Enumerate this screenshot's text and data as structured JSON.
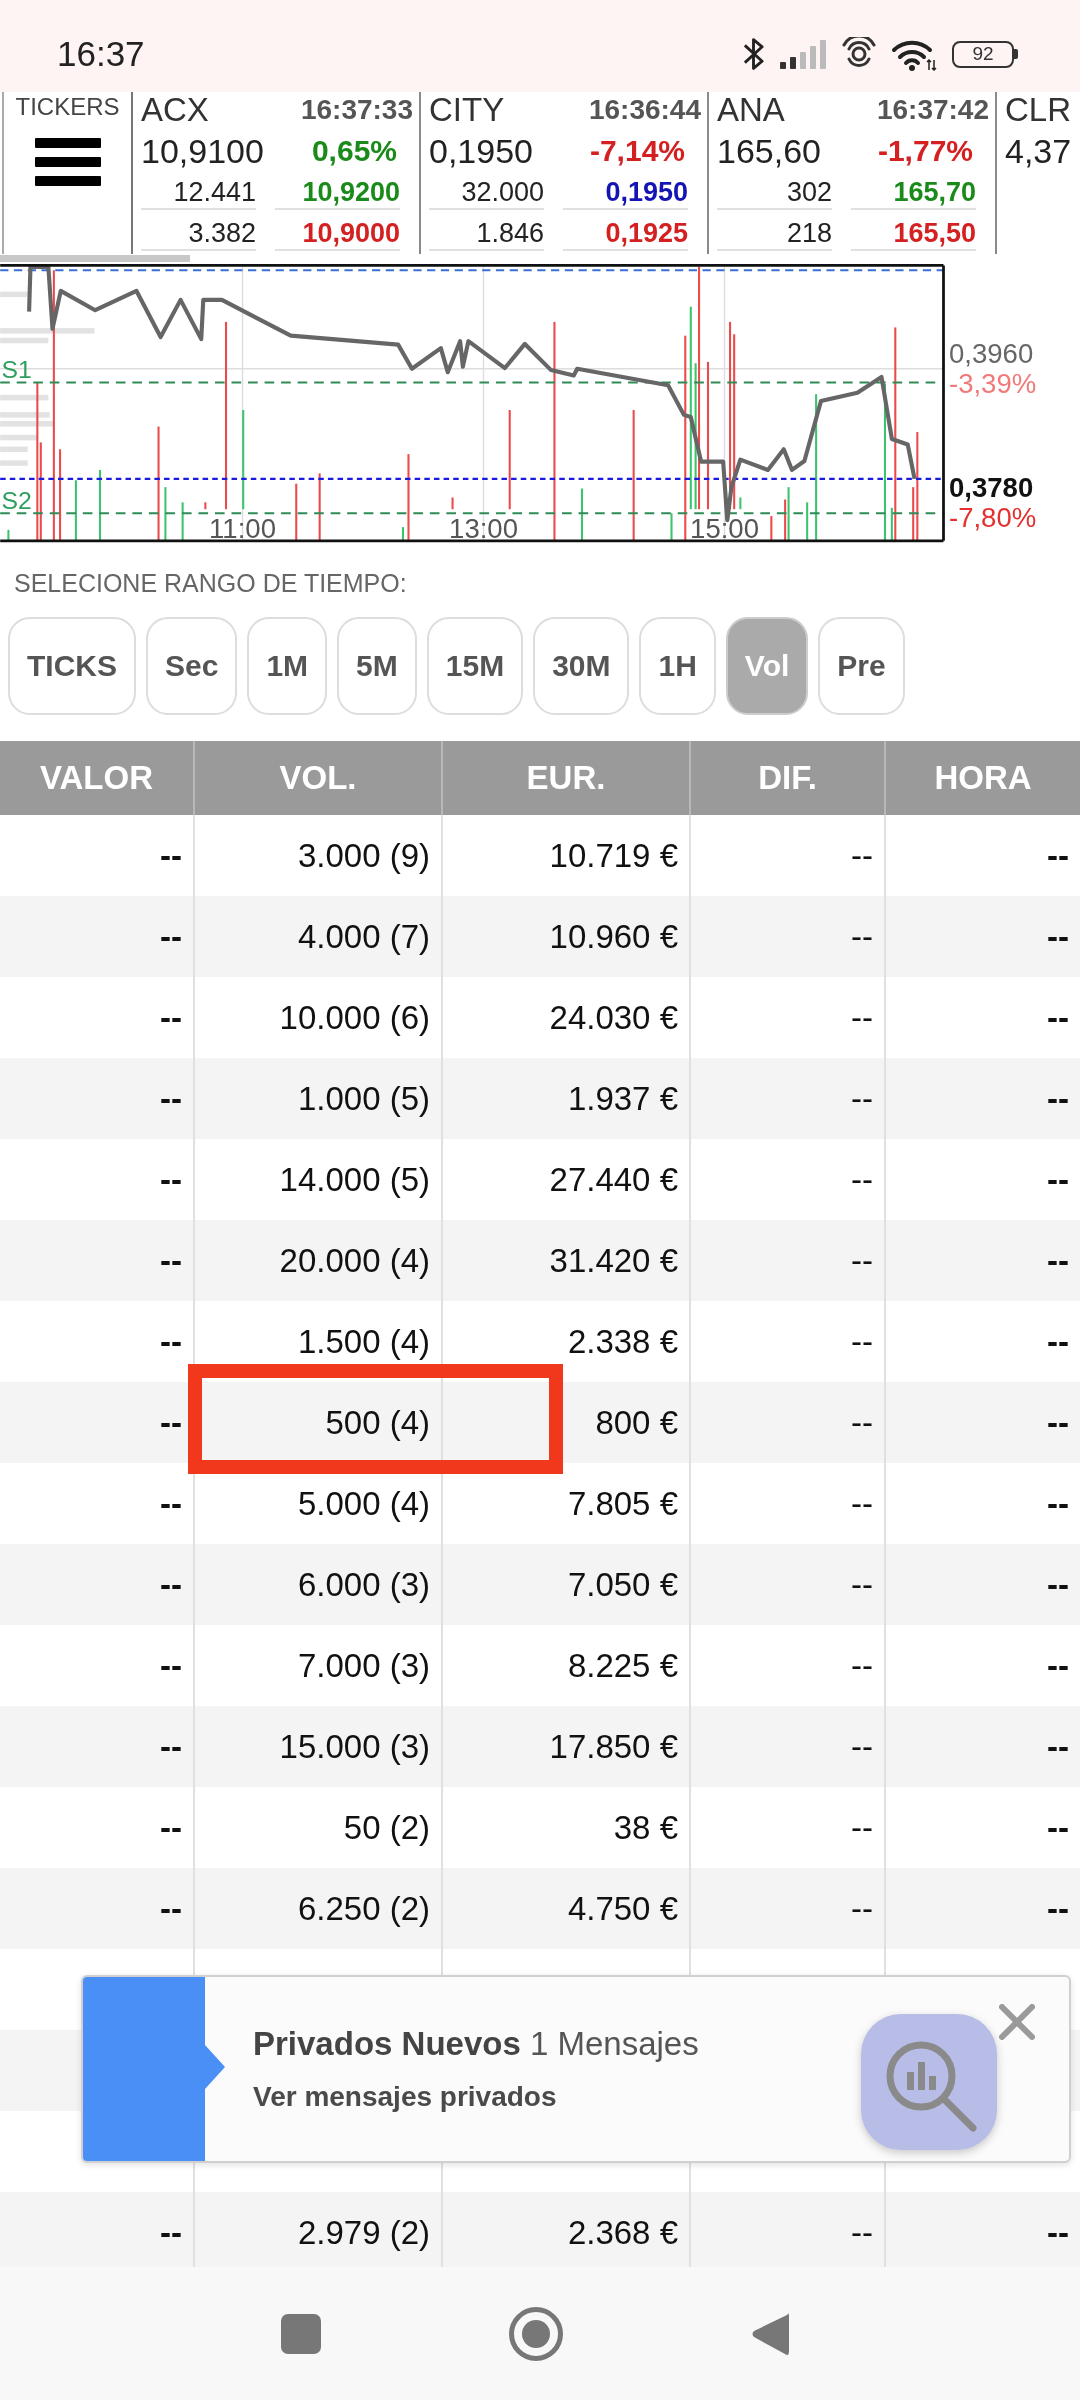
{
  "status_bar": {
    "time": "16:37",
    "battery": "92"
  },
  "tickers": {
    "label": "TICKERS",
    "items": [
      {
        "symbol": "ACX",
        "time": "16:37:33",
        "price": "10,9100",
        "change": {
          "text": "0,65%",
          "color": "#1a8a1a"
        },
        "quotes": [
          {
            "volume": "12.441",
            "price": "10,9200",
            "color": "#1a8a1a"
          },
          {
            "volume": "3.382",
            "price": "10,9000",
            "color": "#d42020"
          }
        ]
      },
      {
        "symbol": "CITY",
        "time": "16:36:44",
        "price": "0,1950",
        "change": {
          "text": "-7,14%",
          "color": "#d42020"
        },
        "quotes": [
          {
            "volume": "32.000",
            "price": "0,1950",
            "color": "#1414b4"
          },
          {
            "volume": "1.846",
            "price": "0,1925",
            "color": "#d42020"
          }
        ]
      },
      {
        "symbol": "ANA",
        "time": "16:37:42",
        "price": "165,60",
        "change": {
          "text": "-1,77%",
          "color": "#d42020"
        },
        "quotes": [
          {
            "volume": "302",
            "price": "165,70",
            "color": "#1a8a1a"
          },
          {
            "volume": "218",
            "price": "165,50",
            "color": "#d42020"
          }
        ]
      },
      {
        "symbol": "CLR",
        "price": "4,37"
      }
    ]
  },
  "chart": {
    "levels": [
      "S1",
      "S2"
    ],
    "price_labels": [
      {
        "kind": "level",
        "price": "0,3960",
        "change": "-3,39%"
      },
      {
        "kind": "last",
        "price": "0,3780",
        "change": "-7,80%"
      }
    ],
    "time_labels": [
      "11:00",
      "13:00",
      "15:00"
    ]
  },
  "range_selector": {
    "label": "SELECIONE RANGO DE TIEMPO:",
    "options": [
      {
        "label": "TICKS",
        "selected": false
      },
      {
        "label": "Sec",
        "selected": false
      },
      {
        "label": "1M",
        "selected": false
      },
      {
        "label": "5M",
        "selected": false
      },
      {
        "label": "15M",
        "selected": false
      },
      {
        "label": "30M",
        "selected": false
      },
      {
        "label": "1H",
        "selected": false
      },
      {
        "label": "Vol",
        "selected": true
      },
      {
        "label": "Pre",
        "selected": false
      }
    ]
  },
  "table": {
    "columns": [
      "VALOR",
      "VOL.",
      "EUR.",
      "DIF.",
      "HORA"
    ],
    "rows": [
      {
        "cells": [
          "--",
          "3.000 (9)",
          "10.719 €",
          "--",
          "--"
        ],
        "highlighted": false
      },
      {
        "cells": [
          "--",
          "4.000 (7)",
          "10.960 €",
          "--",
          "--"
        ],
        "highlighted": false
      },
      {
        "cells": [
          "--",
          "10.000 (6)",
          "24.030 €",
          "--",
          "--"
        ],
        "highlighted": false
      },
      {
        "cells": [
          "--",
          "1.000 (5)",
          "1.937 €",
          "--",
          "--"
        ],
        "highlighted": false
      },
      {
        "cells": [
          "--",
          "14.000 (5)",
          "27.440 €",
          "--",
          "--"
        ],
        "highlighted": false
      },
      {
        "cells": [
          "--",
          "20.000 (4)",
          "31.420 €",
          "--",
          "--"
        ],
        "highlighted": false
      },
      {
        "cells": [
          "--",
          "1.500 (4)",
          "2.338 €",
          "--",
          "--"
        ],
        "highlighted": false
      },
      {
        "cells": [
          "--",
          "500 (4)",
          "800 €",
          "--",
          "--"
        ],
        "highlighted": true
      },
      {
        "cells": [
          "--",
          "5.000 (4)",
          "7.805 €",
          "--",
          "--"
        ],
        "highlighted": false
      },
      {
        "cells": [
          "--",
          "6.000 (3)",
          "7.050 €",
          "--",
          "--"
        ],
        "highlighted": false
      },
      {
        "cells": [
          "--",
          "7.000 (3)",
          "8.225 €",
          "--",
          "--"
        ],
        "highlighted": false
      },
      {
        "cells": [
          "--",
          "15.000 (3)",
          "17.850 €",
          "--",
          "--"
        ],
        "highlighted": false
      },
      {
        "cells": [
          "--",
          "50 (2)",
          "38 €",
          "--",
          "--"
        ],
        "highlighted": false
      },
      {
        "cells": [
          "--",
          "6.250 (2)",
          "4.750 €",
          "--",
          "--"
        ],
        "highlighted": false
      },
      {
        "cells": [
          "--",
          "2.979 (2)",
          "2.368 €",
          "--",
          "--"
        ],
        "highlighted": false
      }
    ]
  },
  "notification": {
    "title": "**Privados Nuevos** 1 Mensajes",
    "subtitle": "Ver mensajes privados"
  }
}
